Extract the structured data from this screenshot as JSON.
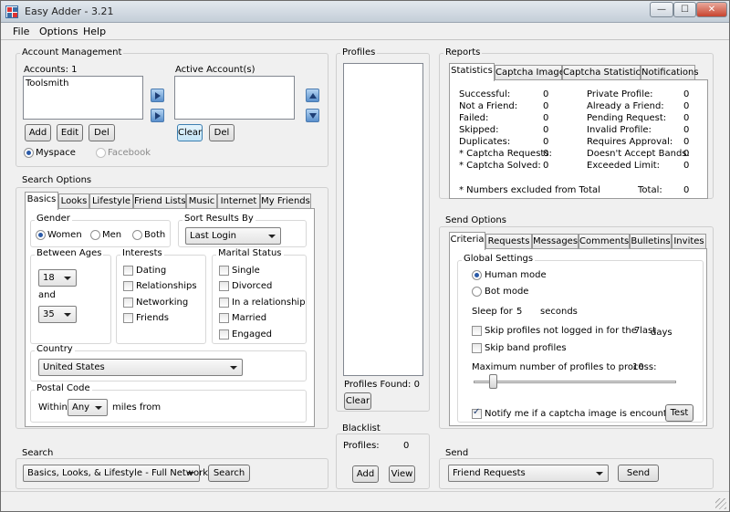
{
  "window": {
    "title": "Easy Adder - 3.21",
    "minimize": "—",
    "maximize": "☐",
    "close": "✕"
  },
  "menu": [
    "File",
    "Options",
    "Help"
  ],
  "account": {
    "group": "Account Management",
    "accounts_label": "Accounts: 1",
    "accounts": [
      "Toolsmith"
    ],
    "active_label": "Active Account(s)",
    "add": "Add",
    "edit": "Edit",
    "del": "Del",
    "clear": "Clear",
    "del2": "Del",
    "myspace": "Myspace",
    "facebook": "Facebook"
  },
  "search_options": {
    "group": "Search Options",
    "tabs": [
      "Basics",
      "Looks",
      "Lifestyle",
      "Friend Lists",
      "Music",
      "Internet",
      "My Friends"
    ],
    "gender": {
      "label": "Gender",
      "options": [
        "Women",
        "Men",
        "Both"
      ],
      "selected": "Women"
    },
    "sort": {
      "label": "Sort Results By",
      "value": "Last Login"
    },
    "ages": {
      "label": "Between Ages",
      "min": "18",
      "and": "and",
      "max": "35"
    },
    "interests": {
      "label": "Interests",
      "items": [
        "Dating",
        "Relationships",
        "Networking",
        "Friends"
      ]
    },
    "marital": {
      "label": "Marital Status",
      "items": [
        "Single",
        "Divorced",
        "In a relationship",
        "Married",
        "Engaged"
      ]
    },
    "country": {
      "label": "Country",
      "value": "United States"
    },
    "postal": {
      "label": "Postal Code",
      "within": "Within",
      "value": "Any",
      "suffix": "miles from"
    }
  },
  "search": {
    "group": "Search",
    "value": "Basics, Looks, & Lifestyle - Full Network",
    "button": "Search"
  },
  "profiles": {
    "group": "Profiles",
    "found": "Profiles Found: 0",
    "clear": "Clear"
  },
  "blacklist": {
    "group": "Blacklist",
    "label": "Profiles:",
    "count": "0",
    "add": "Add",
    "view": "View"
  },
  "reports": {
    "group": "Reports",
    "tabs": [
      "Statistics",
      "Captcha Image",
      "Captcha Statistics",
      "Notifications"
    ],
    "left": [
      {
        "label": "Successful:",
        "value": "0"
      },
      {
        "label": "Not a Friend:",
        "value": "0"
      },
      {
        "label": "Failed:",
        "value": "0"
      },
      {
        "label": "Skipped:",
        "value": "0"
      },
      {
        "label": "Duplicates:",
        "value": "0"
      },
      {
        "label": "* Captcha Requests:",
        "value": "0"
      },
      {
        "label": "* Captcha Solved:",
        "value": "0"
      }
    ],
    "right": [
      {
        "label": "Private Profile:",
        "value": "0"
      },
      {
        "label": "Already a Friend:",
        "value": "0"
      },
      {
        "label": "Pending Request:",
        "value": "0"
      },
      {
        "label": "Invalid Profile:",
        "value": "0"
      },
      {
        "label": "Requires Approval:",
        "value": "0"
      },
      {
        "label": "Doesn't Accept Bands:",
        "value": "0"
      },
      {
        "label": "Exceeded Limit:",
        "value": "0"
      }
    ],
    "note": "* Numbers excluded from Total",
    "total_label": "Total:",
    "total_value": "0"
  },
  "send_options": {
    "group": "Send Options",
    "tabs": [
      "Criteria",
      "Requests",
      "Messages",
      "Comments",
      "Bulletins",
      "Invites"
    ],
    "global": "Global Settings",
    "human": "Human mode",
    "bot": "Bot mode",
    "mode": "human",
    "sleep_for": "Sleep for",
    "sleep_value": "5",
    "seconds": "seconds",
    "skip_login": "Skip profiles not logged in for the last",
    "skip_days_value": "7",
    "days": "days",
    "skip_band": "Skip band profiles",
    "max_label": "Maximum number of profiles to process:",
    "max_value": "10",
    "slider_level": 0.05,
    "notify": "Notify me if a captcha image is encountered",
    "test": "Test"
  },
  "send": {
    "group": "Send",
    "value": "Friend Requests",
    "button": "Send"
  }
}
